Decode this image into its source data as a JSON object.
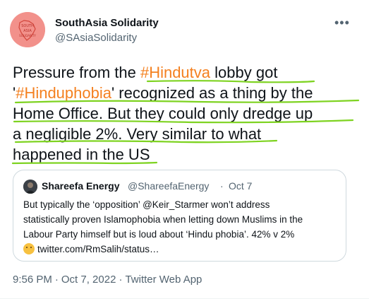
{
  "author": {
    "name": "SouthAsia Solidarity",
    "handle": "@SAsiaSolidarity",
    "avatar_text": "SOUTH ASIA SOLIDARITY"
  },
  "more_icon": "more-horizontal-icon",
  "tweet": {
    "lines": [
      {
        "pre": "Pressure from the ",
        "tag": "#Hindutva",
        "post": " lobby got"
      },
      {
        "pre": "'",
        "tag": "#Hinduphobia",
        "post": "' recognized as a thing by the"
      },
      {
        "pre": "Home Office. But they could only dredge up",
        "tag": "",
        "post": ""
      },
      {
        "pre": "a negligible 2%. Very similar to what",
        "tag": "",
        "post": ""
      },
      {
        "pre": "happened in the US",
        "tag": "",
        "post": ""
      }
    ]
  },
  "quote": {
    "name": "Shareefa Energy",
    "handle": "@ShareefaEnergy",
    "separator": "·",
    "date": "Oct 7",
    "lines": [
      "But typically the ‘opposition’ @Keir_Starmer won’t address",
      "statistically proven Islamophobia when letting down Muslims in the",
      "Labour Party himself but is loud about ‘Hindu phobia’. 42% v 2%",
      "twitter.com/RmSalih/status…"
    ],
    "emoji": "thinking-face-emoji"
  },
  "meta": {
    "time": "9:56 PM",
    "separator": "·",
    "date": "Oct 7, 2022",
    "source": "Twitter Web App"
  },
  "colors": {
    "hashtag": "#f4801f",
    "underline": "#7ed321",
    "text": "#0f1419",
    "secondary": "#536471"
  }
}
